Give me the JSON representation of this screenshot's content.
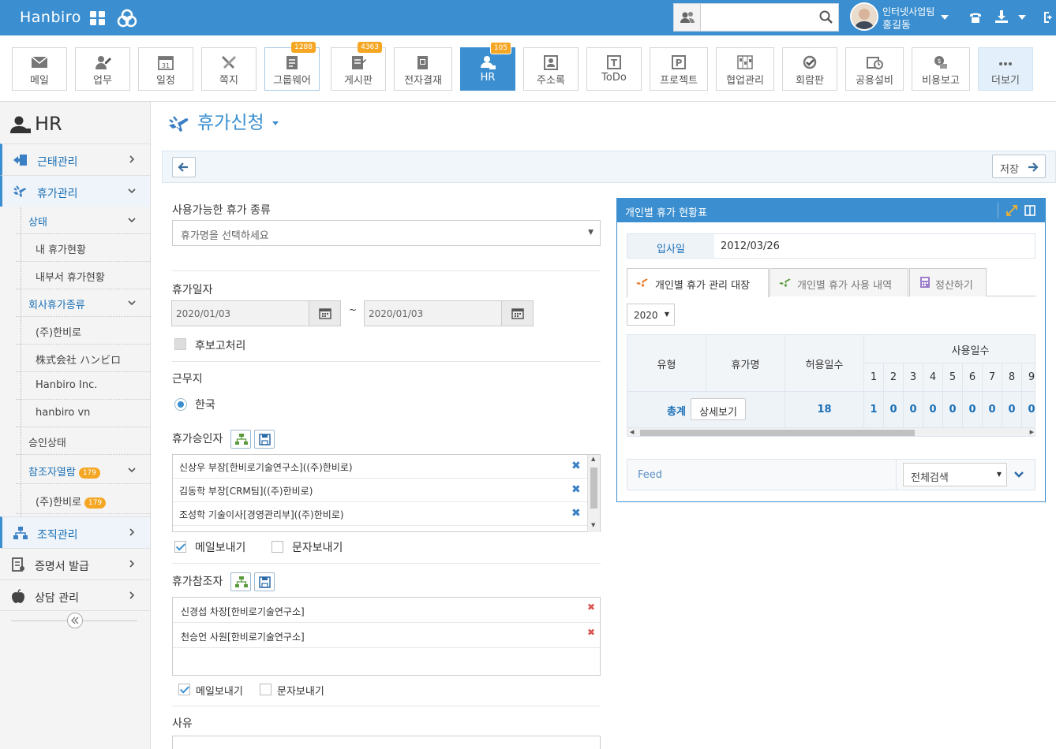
{
  "topbar": {
    "brand": "Hanbiro",
    "user_team": "인터넷사업팀",
    "user_name": "홍길동",
    "search_placeholder": ""
  },
  "apps": [
    {
      "label": "메일",
      "badge": ""
    },
    {
      "label": "업무",
      "badge": ""
    },
    {
      "label": "일정",
      "badge": ""
    },
    {
      "label": "쪽지",
      "badge": ""
    },
    {
      "label": "그룹웨어",
      "badge": "1288"
    },
    {
      "label": "게시판",
      "badge": "4363"
    },
    {
      "label": "전자결재",
      "badge": ""
    },
    {
      "label": "HR",
      "badge": "105"
    },
    {
      "label": "주소록",
      "badge": ""
    },
    {
      "label": "ToDo",
      "badge": ""
    },
    {
      "label": "프로젝트",
      "badge": ""
    },
    {
      "label": "협업관리",
      "badge": ""
    },
    {
      "label": "회람판",
      "badge": ""
    },
    {
      "label": "공용설비",
      "badge": ""
    },
    {
      "label": "비용보고",
      "badge": ""
    },
    {
      "label": "더보기",
      "badge": ""
    }
  ],
  "sidebar": {
    "title": "HR",
    "attendance": "근태관리",
    "leave": "휴가관리",
    "status": "상태",
    "my_leave": "내 휴가현황",
    "dept_leave": "내부서 휴가현황",
    "company_types": "회사휴가종류",
    "co1": "(주)한비로",
    "co2": "株式会社 ハンビロ",
    "co3": "Hanbiro Inc.",
    "co4": "hanbiro vn",
    "approval_status": "승인상태",
    "cc_view": "참조자열람",
    "cc_view_badge": "179",
    "cc_co": "(주)한비로",
    "cc_co_badge": "179",
    "org": "조직관리",
    "cert": "증명서 발급",
    "counsel": "상담 관리"
  },
  "page": {
    "title": "휴가신청",
    "save": "저장",
    "leave_type_label": "사용가능한 휴가 종류",
    "leave_type_placeholder": "휴가명을 선택하세요",
    "date_label": "휴가일자",
    "date_from": "2020/01/03",
    "date_to": "2020/01/03",
    "tilde": "~",
    "post_report": "후보고처리",
    "workplace_label": "근무지",
    "workplace_value": "한국",
    "approver_label": "휴가승인자",
    "approvers": [
      "신상우 부장[한비로기술연구소]((주)한비로)",
      "김동학 부장[CRM팀]((주)한비로)",
      "조성학 기술이사[경영관리부]((주)한비로)"
    ],
    "send_mail": "메일보내기",
    "send_sms": "문자보내기",
    "cc_label": "휴가참조자",
    "cc_list": [
      "신경섭 차장[한비로기술연구소]",
      "천승언 사원[한비로기술연구소]"
    ],
    "send_mail2": "메일보내기",
    "send_sms2": "문자보내기",
    "reason_label": "사유"
  },
  "panel": {
    "title": "개인별 휴가 현황표",
    "join_label": "입사일",
    "join_date": "2012/03/26",
    "tab1": "개인별 휴가 관리 대장",
    "tab2": "개인별 휴가 사용 내역",
    "tab3": "정산하기",
    "year": "2020",
    "col_type": "유형",
    "col_name": "휴가명",
    "col_allowed": "허용일수",
    "col_used": "사용일수",
    "months": [
      "1",
      "2",
      "3",
      "4",
      "5",
      "6",
      "7",
      "8",
      "9"
    ],
    "total_label": "총계",
    "detail_btn": "상세보기",
    "total_allowed": "18",
    "used_values": [
      "1",
      "0",
      "0",
      "0",
      "0",
      "0",
      "0",
      "0",
      "0"
    ],
    "feed_label": "Feed",
    "feed_select": "전체검색"
  }
}
